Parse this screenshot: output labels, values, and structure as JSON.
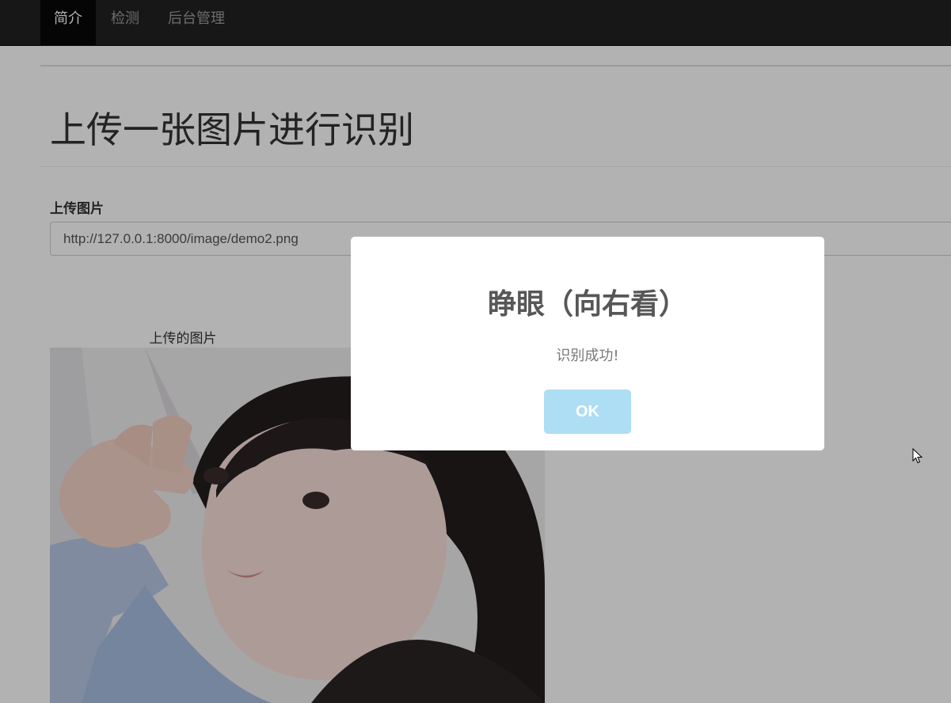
{
  "navbar": {
    "items": [
      {
        "label": "简介",
        "active": true
      },
      {
        "label": "检测",
        "active": false
      },
      {
        "label": "后台管理",
        "active": false
      }
    ]
  },
  "page": {
    "title": "上传一张图片进行识别",
    "upload_label": "上传图片",
    "upload_value": "http://127.0.0.1:8000/image/demo2.png",
    "image_caption": "上传的图片"
  },
  "dialog": {
    "title": "睁眼（向右看）",
    "message": "识别成功!",
    "ok_label": "OK"
  },
  "colors": {
    "navbar_bg": "#222222",
    "ok_button": "#aedef4",
    "dialog_title": "#575757"
  }
}
